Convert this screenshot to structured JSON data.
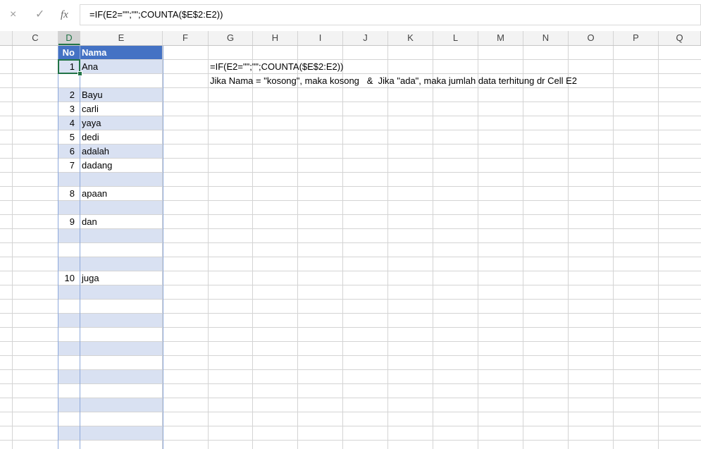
{
  "formula_bar": {
    "cancel_icon": "×",
    "enter_icon": "✓",
    "fx_label": "fx",
    "formula": "=IF(E2=\"\";\"\";COUNTA($E$2:E2))"
  },
  "columns": [
    "C",
    "D",
    "E",
    "F",
    "G",
    "H",
    "I",
    "J",
    "K",
    "L",
    "M",
    "N",
    "O",
    "P",
    "Q"
  ],
  "selected_column": "D",
  "table": {
    "header_no": "No",
    "header_nama": "Nama",
    "rows": [
      {
        "no": "1",
        "nama": "Ana"
      },
      {
        "no": "",
        "nama": ""
      },
      {
        "no": "2",
        "nama": "Bayu"
      },
      {
        "no": "3",
        "nama": "carli"
      },
      {
        "no": "4",
        "nama": "yaya"
      },
      {
        "no": "5",
        "nama": "dedi"
      },
      {
        "no": "6",
        "nama": "adalah"
      },
      {
        "no": "7",
        "nama": "dadang"
      },
      {
        "no": "",
        "nama": ""
      },
      {
        "no": "8",
        "nama": "apaan"
      },
      {
        "no": "",
        "nama": ""
      },
      {
        "no": "9",
        "nama": "dan"
      },
      {
        "no": "",
        "nama": ""
      },
      {
        "no": "",
        "nama": ""
      },
      {
        "no": "",
        "nama": ""
      },
      {
        "no": "10",
        "nama": "juga"
      }
    ]
  },
  "notes": {
    "formula_text": "=IF(E2=\"\";\"\";COUNTA($E$2:E2))",
    "explanation": "Jika Nama = \"kosong\", maka kosong   &  Jika \"ada\", maka jumlah data terhitung dr Cell E2"
  },
  "colors": {
    "header_fill": "#4472c4",
    "band_fill": "#d9e1f2",
    "selection": "#217346"
  }
}
